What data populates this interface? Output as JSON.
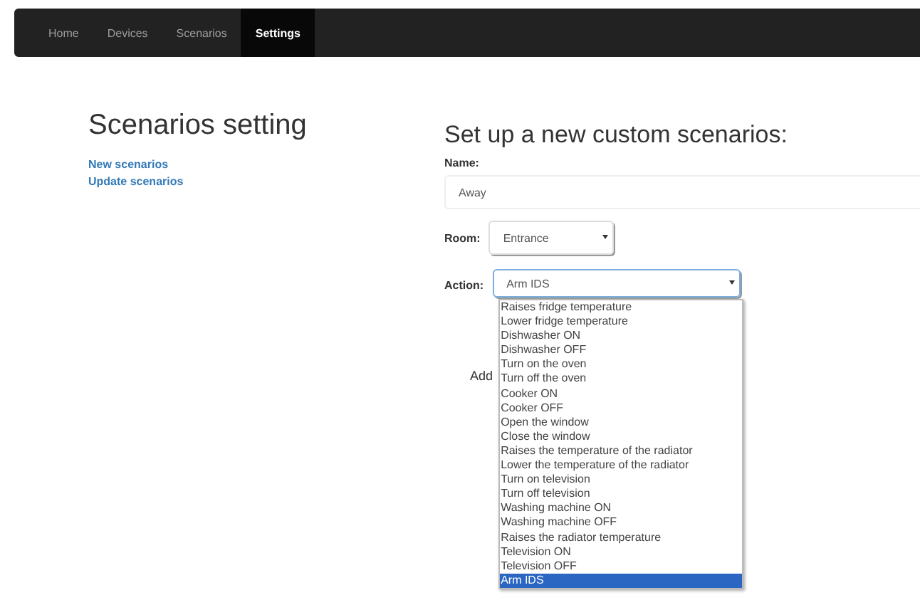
{
  "navbar": {
    "tabs": [
      {
        "label": "Home",
        "selected": false
      },
      {
        "label": "Devices",
        "selected": false
      },
      {
        "label": "Scenarios",
        "selected": false
      },
      {
        "label": "Settings",
        "selected": true
      }
    ]
  },
  "sidebar": {
    "title": "Scenarios setting",
    "links": [
      "New scenarios",
      "Update scenarios"
    ]
  },
  "form": {
    "title": "Set up a new custom scenarios:",
    "name_label": "Name:",
    "name_value": "Away",
    "room_label": "Room:",
    "room_value": "Entrance",
    "action_label": "Action:",
    "action_value": "Arm IDS",
    "add_label": "Add",
    "action_options": [
      {
        "label": "Raises fridge temperature",
        "selected": false
      },
      {
        "label": "Lower fridge temperature",
        "selected": false
      },
      {
        "label": "Dishwasher ON",
        "selected": false
      },
      {
        "label": "Dishwasher OFF",
        "selected": false
      },
      {
        "label": "Turn on the oven",
        "selected": false
      },
      {
        "label": "Turn off the oven",
        "selected": false
      },
      {
        "label": "Cooker ON",
        "selected": false
      },
      {
        "label": "Cooker OFF",
        "selected": false
      },
      {
        "label": "Open the window",
        "selected": false
      },
      {
        "label": "Close the window",
        "selected": false
      },
      {
        "label": "Raises the temperature of the radiator",
        "selected": false
      },
      {
        "label": "Lower the temperature of the radiator",
        "selected": false
      },
      {
        "label": "Turn on television",
        "selected": false
      },
      {
        "label": "Turn off television",
        "selected": false
      },
      {
        "label": "Washing machine ON",
        "selected": false
      },
      {
        "label": "Washing machine OFF",
        "selected": false
      },
      {
        "label": "Raises the radiator temperature",
        "selected": false
      },
      {
        "label": "Television ON",
        "selected": false
      },
      {
        "label": "Television OFF",
        "selected": false
      },
      {
        "label": "Arm IDS",
        "selected": true
      }
    ]
  }
}
